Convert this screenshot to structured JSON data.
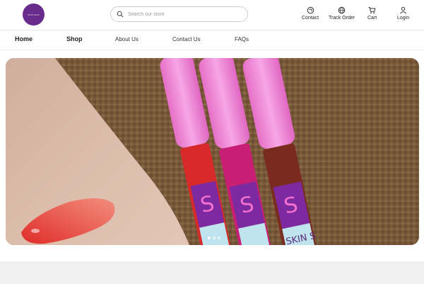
{
  "brand": {
    "logo_text": "SKIN SKIN",
    "accent": "#6a2c8c"
  },
  "search": {
    "placeholder": "Search our store",
    "icon": "search-icon"
  },
  "header_actions": [
    {
      "label": "Contact",
      "icon": "contact-icon"
    },
    {
      "label": "Track Order",
      "icon": "globe-icon"
    },
    {
      "label": "Cart",
      "icon": "cart-icon"
    },
    {
      "label": "Login",
      "icon": "user-icon"
    }
  ],
  "nav": {
    "items": [
      {
        "label": "Home"
      },
      {
        "label": "Shop"
      },
      {
        "label": "About Us"
      },
      {
        "label": "Contact Us"
      },
      {
        "label": "FAQs"
      }
    ]
  },
  "hero": {
    "alt": "Lip gloss tubes next to a swatch on skin",
    "product_text": "SKIN S",
    "active_slide": 1,
    "slides_count": 3
  }
}
